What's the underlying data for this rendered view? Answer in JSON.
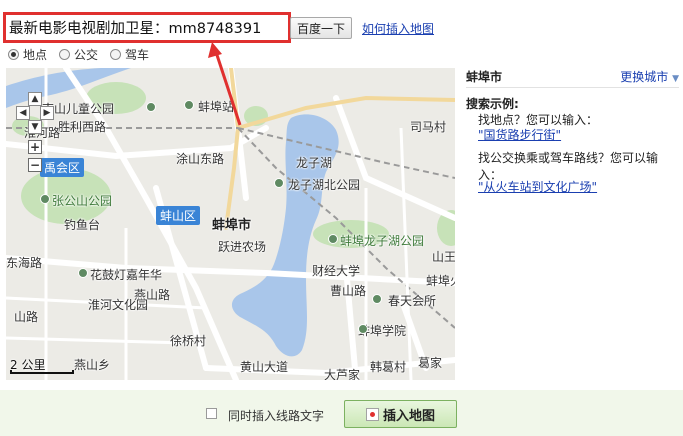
{
  "search": {
    "value": "最新电影电视剧加卫星：mm8748391",
    "button_label": "百度一下",
    "help_link": "如何插入地图"
  },
  "modes": [
    {
      "label": "地点",
      "selected": true
    },
    {
      "label": "公交",
      "selected": false
    },
    {
      "label": "驾车",
      "selected": false
    }
  ],
  "map": {
    "labels": {
      "nanshan_park": "南山儿童公园",
      "bengbu_station": "蚌埠站",
      "shengli_road": "胜利西路",
      "huaihe_road": "淮河路",
      "tushan_east": "涂山东路",
      "longzi_lake": "龙子湖",
      "longzi_north_park": "龙子湖北公园",
      "yuhui_district": "禹会区",
      "zhangshan_park": "张公山公园",
      "diaoyutai": "钓鱼台",
      "bengshan_district": "蚌山区",
      "bengbu_city": "蚌埠市",
      "yuejin_farm": "跃进农场",
      "longzi_park": "蚌埠龙子湖公园",
      "shanwang": "山王",
      "donghai_road": "东海路",
      "huagu_zone": "花鼓灯嘉年华",
      "yanshan_road": "燕山路",
      "caidu_university": "财经大学",
      "bengbu_huo": "蚌埠火",
      "huaihe_culture": "淮河文化园",
      "caoshan_road": "曹山路",
      "chunyi_hall": "春天会所",
      "xuqiao": "徐桥村",
      "bengbu_college": "蚌埠学院",
      "huangshan_ave": "黄山大道",
      "hanzhuang": "韩葛村",
      "gejia": "葛家",
      "dalu": "大芦家",
      "simacun": "司马村",
      "yanshanxiang": "燕山乡",
      "shanli_road": "山路"
    },
    "scale_label": "2 公里"
  },
  "side": {
    "city": "蚌埠市",
    "change_city": "更换城市",
    "example_title": "搜索示例:",
    "find_place_text": "找地点？您可以输入：",
    "find_place_example": "国货路步行街",
    "bus_text": "找公交换乘或驾车路线？您可以输入：",
    "bus_example": "从火车站到文化广场"
  },
  "bottom": {
    "checkbox_label": "同时插入线路文字",
    "insert_button": "插入地图"
  },
  "colors": {
    "search_border": "#e0302f",
    "link": "#1a3fb0",
    "water": "#a9c6ea",
    "park": "#c7e2b8",
    "bottom_bg": "#f1f7ea"
  }
}
